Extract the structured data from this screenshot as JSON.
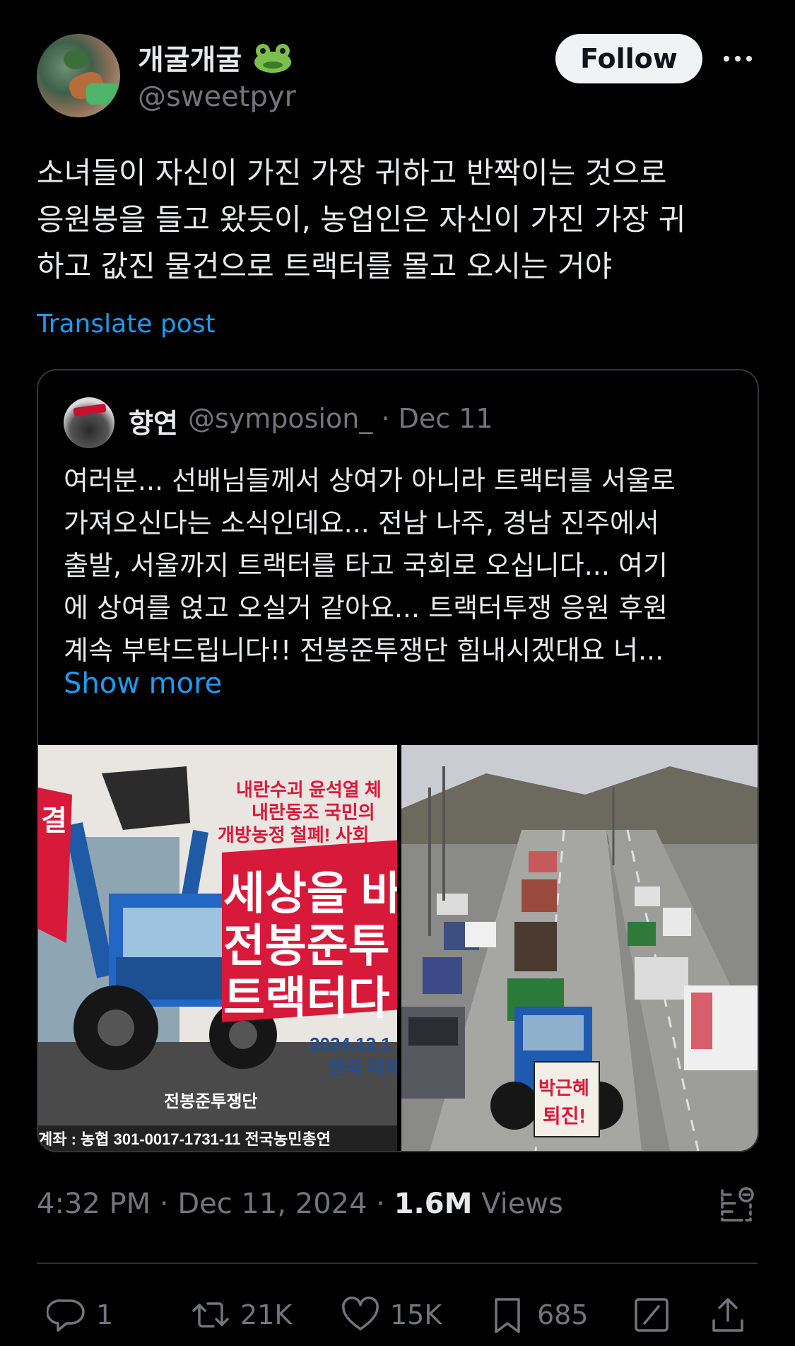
{
  "author": {
    "display_name": "개굴개굴",
    "handle": "@sweetpyr",
    "badge_icon": "frog-face-icon"
  },
  "follow_label": "Follow",
  "post_text": "소녀들이 자신이 가진 가장 귀하고 반짝이는 것으로\n응원봉을 들고 왔듯이, 농업인은 자신이 가진 가장 귀\n하고 값진 물건으로 트랙터를 몰고 오시는 거야",
  "translate_label": "Translate post",
  "quote": {
    "name": "향연",
    "handle_date": "@symposion_ · Dec 11",
    "text": "여러분... 선배님들께서 상여가 아니라 트랙터를 서울로\n가져오신다는 소식인데요... 전남 나주, 경남 진주에서\n출발, 서울까지 트랙터를 타고 국회로 오십니다... 여기\n에 상여를 얹고 오실거 같아요... 트랙터투쟁 응원 후원\n계속 부탁드립니다!! 전봉준투쟁단 힘내시겠대요 너...",
    "show_more": "Show more",
    "poster": {
      "line1": "내란수괴 윤석열 체",
      "line2": "내란동조 국민의",
      "line3": "개방농정 철폐! 사회",
      "headline1": "세상을 바",
      "headline2": "전봉준투",
      "headline3": "트랙터다",
      "date": "2024.12.1",
      "sub": "전국 각지",
      "org": "전봉준투쟁단",
      "account": "계좌 : 농협 301-0017-1731-11 전국농민총연",
      "flag": "결"
    },
    "sign": {
      "line1": "박근혜",
      "line2": "퇴진!"
    }
  },
  "meta": {
    "time_date": "4:32 PM · Dec 11, 2024 · ",
    "views_count": "1.6M",
    "views_label": " Views"
  },
  "actions": {
    "replies": "1",
    "reposts": "21K",
    "likes": "15K",
    "bookmarks": "685"
  },
  "colors": {
    "background": "#000000",
    "text": "#e7e9ea",
    "muted": "#71767b",
    "link": "#1d9bf0",
    "poster_red": "#d7193a"
  }
}
